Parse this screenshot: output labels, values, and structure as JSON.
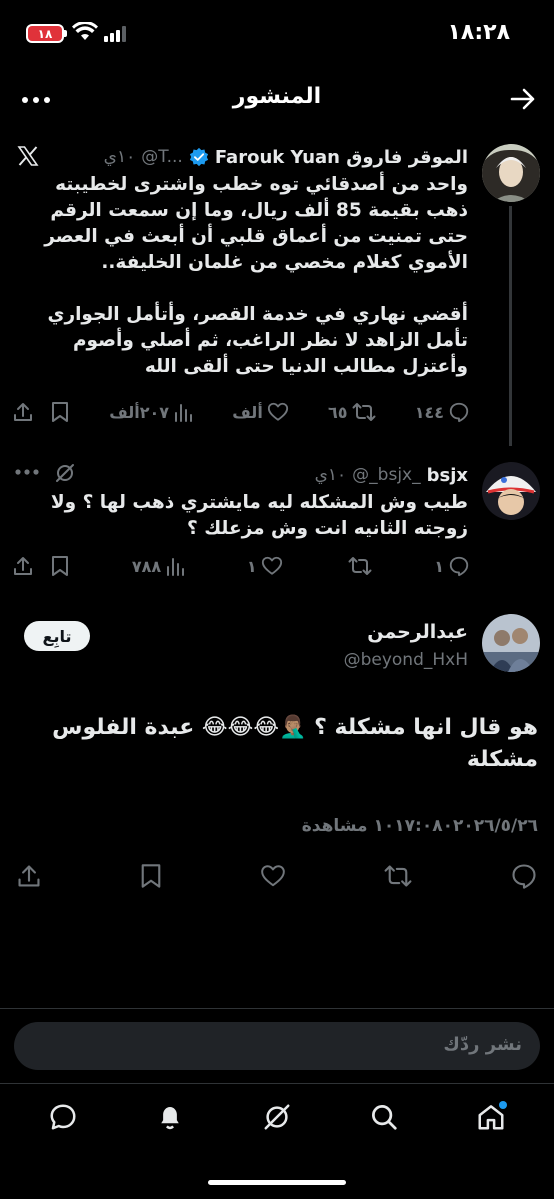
{
  "status": {
    "time": "١٨:٢٨",
    "battery": "١٨"
  },
  "header": {
    "title": "المنشور",
    "back_icon": "arrow-right-icon",
    "more_icon": "more-dots-icon"
  },
  "tweets": [
    {
      "name": "الموقر فاروق Farouk Yuan",
      "handle": "@T...",
      "time": "١٠ي",
      "source_icon": "x-logo-icon",
      "verified": true,
      "body": "واحد من أصدقائي توه خطب واشترى لخطيبته ذهب بقيمة 85 ألف ريال، وما إن سمعت الرقم حتى تمنيت من أعماق قلبي أن أبعث في العصر الأموي كغلام مخصي من غلمان الخليفة..\n\nأقضي نهاري في خدمة القصر، وأتأمل الجواري تأمل الزاهد لا نظر الراغب، ثم أصلي وأصوم وأعتزل مطالب الدنيا حتى ألقى الله",
      "replies": "١٤٤",
      "retweets": "٦٥",
      "likes": "ألف",
      "views": "٢٠٧ألف"
    },
    {
      "name": "bsjx",
      "handle": "@_bsjx_",
      "time": "١٠ي",
      "body": "طيب وش المشكله ليه مايشتري ذهب لها ؟ ولا زوجته الثانيه انت وش مزعلك ؟",
      "replies": "١",
      "retweets": "",
      "likes": "١",
      "views": "٧٨٨"
    }
  ],
  "main_post": {
    "name": "عبدالرحمن",
    "handle": "@beyond_HxH",
    "follow_label": "تابِع",
    "text": "هو قال انها مشكلة ؟ 🤦🏽‍♂️😂😂😂 عبدة الفلوس مشكلة",
    "meta": "١٠١٧:٠٨٠٢٠٢٦/٥/٢٦ مشاهدة"
  },
  "reply_box": {
    "placeholder": "نشر ردّك"
  },
  "bottom_nav": [
    {
      "icon": "home-icon",
      "active": true
    },
    {
      "icon": "search-icon"
    },
    {
      "icon": "grok-icon"
    },
    {
      "icon": "notifications-icon"
    },
    {
      "icon": "messages-icon"
    }
  ],
  "colors": {
    "background": "#000000",
    "text": "#e7e9ea",
    "muted": "#71767b",
    "accent": "#1d9bf0",
    "verified": "#1d9bf0",
    "battery_low": "#e0323a"
  }
}
